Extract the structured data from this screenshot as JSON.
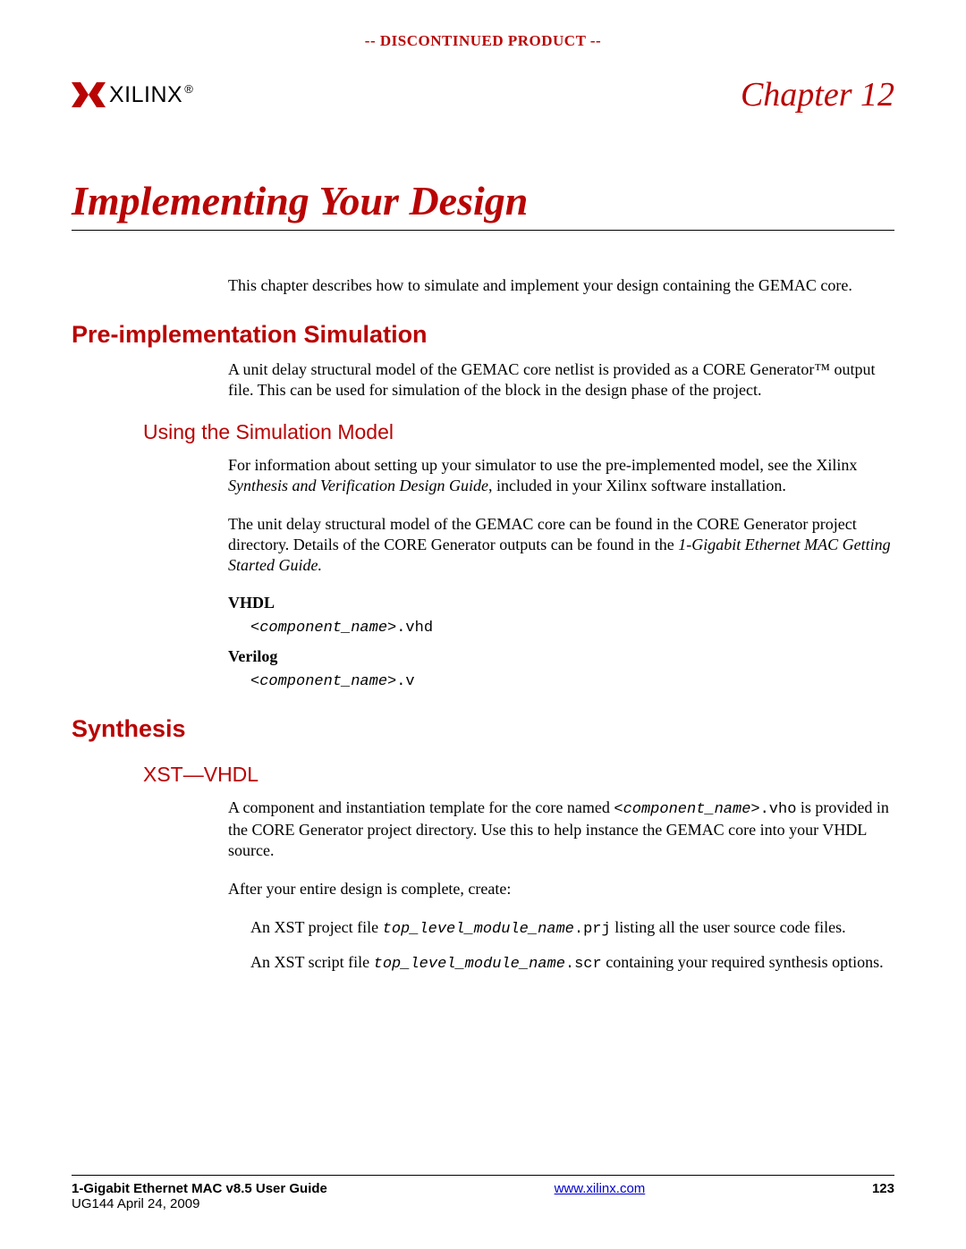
{
  "banner": "-- DISCONTINUED PRODUCT --",
  "logo_text": "XILINX",
  "logo_reg": "®",
  "chapter_label": "Chapter 12",
  "chapter_title": "Implementing Your Design",
  "intro": "This chapter describes how to simulate and implement your design containing the GEMAC core.",
  "section1": {
    "heading": "Pre-implementation Simulation",
    "p1": "A unit delay structural model of the GEMAC core netlist is provided as a CORE Generator™ output file. This can be used for simulation of the block in the design phase of the project.",
    "sub1": {
      "heading": "Using the Simulation Model",
      "p1_a": "For information about setting up your simulator to use the pre-implemented model, see the Xilinx ",
      "p1_i": "Synthesis and Verification Design Guide",
      "p1_b": ", included in your Xilinx software installation.",
      "p2_a": "The unit delay structural model of the GEMAC core can be found in the CORE Generator project directory. Details of the CORE Generator outputs can be found in the ",
      "p2_i": "1-Gigabit Ethernet MAC Getting Started Guide.",
      "vhdl_h": "VHDL",
      "vhdl_code_name": "<component_name>",
      "vhdl_code_ext": ".vhd",
      "verilog_h": "Verilog",
      "verilog_code_name": "<component_name>",
      "verilog_code_ext": ".v"
    }
  },
  "section2": {
    "heading": "Synthesis",
    "sub1": {
      "heading": "XST—VHDL",
      "p1_a": "A component and instantiation template for the core named ",
      "p1_code": "<component_name>",
      "p1_ext": ".vho",
      "p1_b": " is provided in the CORE Generator project directory. Use this to help instance the GEMAC core into your VHDL source.",
      "p2": "After your entire design is complete, create:",
      "li1_a": "An XST project file ",
      "li1_code": "top_level_module_name",
      "li1_ext": ".prj",
      "li1_b": " listing all the user source code files.",
      "li2_a": "An XST script file ",
      "li2_code": "top_level_module_name",
      "li2_ext": ".scr",
      "li2_b": " containing your required synthesis options."
    }
  },
  "footer": {
    "title": "1-Gigabit Ethernet MAC v8.5 User Guide",
    "sub": "UG144 April 24, 2009",
    "link": "www.xilinx.com",
    "page": "123"
  }
}
